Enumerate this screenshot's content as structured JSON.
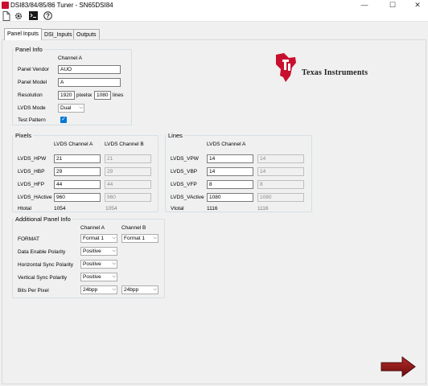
{
  "window": {
    "title": "DSI83/84/85/86 Tuner - SN65DSI84",
    "minimize": "—",
    "maximize": "☐",
    "close": "✕"
  },
  "toolbar": {
    "new_icon": "new-document-icon",
    "settings_icon": "gear-icon",
    "terminal_icon": "terminal-icon",
    "help_icon": "help-icon"
  },
  "tabs": [
    {
      "label": "Panel Inputs",
      "active": true
    },
    {
      "label": "DSI_Inputs"
    },
    {
      "label": "Outputs"
    }
  ],
  "brand": {
    "name": "Texas Instruments",
    "text": "Texas Instruments",
    "color": "#c8102e"
  },
  "panel_info": {
    "legend": "Panel Info",
    "channel_header": "Channel A",
    "vendor_label": "Panel Vendor",
    "vendor_value": "AUO",
    "model_label": "Panel Model",
    "model_value": "A",
    "resolution_label": "Resolution",
    "res_w": "1920",
    "pixels_unit": "pixels",
    "x_sep": "x",
    "res_h": "1080",
    "lines_unit": "lines",
    "lvds_mode_label": "LVDS Mode",
    "lvds_mode_value": "Dual",
    "test_pattern_label": "Test Pattern",
    "test_pattern_checked": true
  },
  "pixels": {
    "legend": "Pixels",
    "col_a": "LVDS Channel A",
    "col_b": "LVDS Channel B",
    "rows": [
      {
        "label": "LVDS_HPW",
        "a": "21",
        "b": "21"
      },
      {
        "label": "LVDS_HBP",
        "a": "29",
        "b": "29"
      },
      {
        "label": "LVDS_HFP",
        "a": "44",
        "b": "44"
      },
      {
        "label": "LVDS_HActive",
        "a": "960",
        "b": "960"
      }
    ],
    "total_label": "Htotal",
    "total_a": "1054",
    "total_b": "1054"
  },
  "lines": {
    "legend": "Lines",
    "col_a": "LVDS Channel A",
    "rows": [
      {
        "label": "LVDS_VPW",
        "a": "14",
        "b": "14"
      },
      {
        "label": "LVDS_VBP",
        "a": "14",
        "b": "14"
      },
      {
        "label": "LVDS_VFP",
        "a": "8",
        "b": "8"
      },
      {
        "label": "LVDS_VActive",
        "a": "1080",
        "b": "1080"
      }
    ],
    "total_label": "Vtotal",
    "total_a": "1116",
    "total_b": "1116"
  },
  "additional": {
    "legend": "Additional Panel Info",
    "col_a": "Channel A",
    "col_b": "Channel B",
    "format_label": "FORMAT",
    "format_a": "Format 1",
    "format_b": "Format 1",
    "de_label": "Data Enable Polarity",
    "de_value": "Positive",
    "hs_label": "Horizontal Sync Polarity",
    "hs_value": "Positive",
    "vs_label": "Vertical Sync Polarity",
    "vs_value": "Positive",
    "bpp_label": "Bits Per Pixel",
    "bpp_a": "24bpp",
    "bpp_b": "24bpp"
  },
  "next_button": {
    "icon": "right-arrow-icon",
    "color": "#8b1a1a"
  }
}
